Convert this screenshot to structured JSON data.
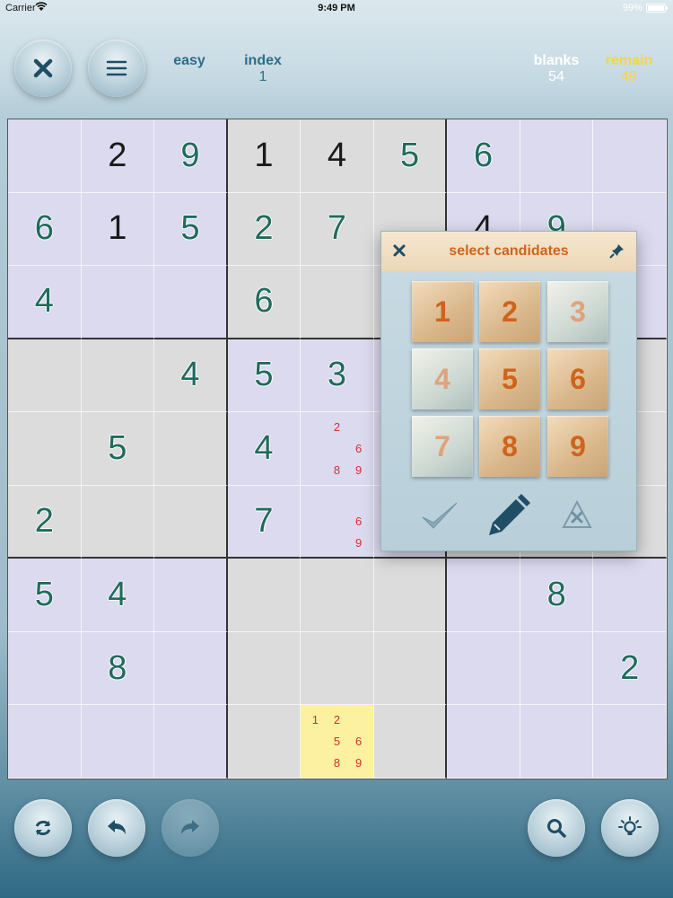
{
  "status": {
    "carrier": "Carrier",
    "time": "9:49 PM",
    "battery": "99%"
  },
  "header": {
    "close_icon": "close-icon",
    "menu_icon": "menu-icon",
    "difficulty": "easy",
    "index_label": "index",
    "index_value": "1",
    "blanks_label": "blanks",
    "blanks_value": "54",
    "remain_label": "remain",
    "remain_value": "49",
    "accent_color": "#2b6f8a",
    "remain_color": "#f3d54a"
  },
  "board": {
    "cells": [
      [
        {
          "v": ""
        },
        {
          "v": "2",
          "t": "given"
        },
        {
          "v": "9",
          "t": "user"
        },
        {
          "v": "1",
          "t": "given"
        },
        {
          "v": "4",
          "t": "given"
        },
        {
          "v": "5",
          "t": "user"
        },
        {
          "v": "6",
          "t": "user"
        },
        {
          "v": ""
        },
        {
          "v": ""
        }
      ],
      [
        {
          "v": "6",
          "t": "user"
        },
        {
          "v": "1",
          "t": "given"
        },
        {
          "v": "5",
          "t": "user"
        },
        {
          "v": "2",
          "t": "user"
        },
        {
          "v": "7",
          "t": "user"
        },
        {
          "v": ""
        },
        {
          "v": "4",
          "t": "given"
        },
        {
          "v": "9",
          "t": "user"
        },
        {
          "v": ""
        }
      ],
      [
        {
          "v": "4",
          "t": "user"
        },
        {
          "v": ""
        },
        {
          "v": ""
        },
        {
          "v": "6",
          "t": "user"
        },
        {
          "v": ""
        },
        {
          "v": ""
        },
        {
          "v": ""
        },
        {
          "v": ""
        },
        {
          "v": ""
        }
      ],
      [
        {
          "v": ""
        },
        {
          "v": ""
        },
        {
          "v": "4",
          "t": "user"
        },
        {
          "v": "5",
          "t": "user"
        },
        {
          "v": "3",
          "t": "user"
        },
        {
          "v": ""
        },
        {
          "v": ""
        },
        {
          "v": ""
        },
        {
          "v": ""
        }
      ],
      [
        {
          "v": ""
        },
        {
          "v": "5",
          "t": "user"
        },
        {
          "v": ""
        },
        {
          "v": "4",
          "t": "user"
        },
        {
          "c": [
            "",
            "2",
            "",
            "",
            "",
            "6",
            "",
            "8",
            "9"
          ]
        },
        {
          "v": ""
        },
        {
          "v": ""
        },
        {
          "v": ""
        },
        {
          "v": ""
        }
      ],
      [
        {
          "v": "2",
          "t": "user"
        },
        {
          "v": ""
        },
        {
          "v": ""
        },
        {
          "v": "7",
          "t": "user"
        },
        {
          "c": [
            "",
            "",
            "",
            "",
            "",
            "6",
            "",
            "",
            "9"
          ]
        },
        {
          "v": ""
        },
        {
          "v": ""
        },
        {
          "v": ""
        },
        {
          "v": ""
        }
      ],
      [
        {
          "v": "5",
          "t": "user"
        },
        {
          "v": "4",
          "t": "user"
        },
        {
          "v": ""
        },
        {
          "v": ""
        },
        {
          "v": ""
        },
        {
          "v": ""
        },
        {
          "v": ""
        },
        {
          "v": "8",
          "t": "user"
        },
        {
          "v": ""
        }
      ],
      [
        {
          "v": ""
        },
        {
          "v": "8",
          "t": "user"
        },
        {
          "v": ""
        },
        {
          "v": ""
        },
        {
          "v": ""
        },
        {
          "v": ""
        },
        {
          "v": ""
        },
        {
          "v": ""
        },
        {
          "v": "2",
          "t": "user"
        }
      ],
      [
        {
          "v": ""
        },
        {
          "v": ""
        },
        {
          "v": ""
        },
        {
          "v": ""
        },
        {
          "c": [
            "1",
            "2",
            "",
            "",
            "5",
            "6",
            "",
            "8",
            "9"
          ],
          "hl": true
        },
        {
          "v": ""
        },
        {
          "v": ""
        },
        {
          "v": ""
        },
        {
          "v": ""
        }
      ]
    ],
    "given_color": "#1a1a1a",
    "user_color": "#1f6b5c",
    "candidate_color": "#d43030",
    "highlight_color": "#fbf1a0"
  },
  "popup": {
    "title": "select candidates",
    "close_icon": "close-icon",
    "pin_icon": "pin-icon",
    "candidates": [
      {
        "label": "1",
        "active": true
      },
      {
        "label": "2",
        "active": true
      },
      {
        "label": "3",
        "active": false
      },
      {
        "label": "4",
        "active": false
      },
      {
        "label": "5",
        "active": true
      },
      {
        "label": "6",
        "active": true
      },
      {
        "label": "7",
        "active": false
      },
      {
        "label": "8",
        "active": true
      },
      {
        "label": "9",
        "active": true
      }
    ],
    "tools": [
      "check-icon",
      "pencil-icon",
      "clear-candidates-icon"
    ],
    "accent_color": "#d0631c"
  },
  "footer": {
    "buttons": [
      "refresh-icon",
      "undo-icon",
      "redo-icon",
      "search-icon",
      "hint-bulb-icon"
    ],
    "redo_enabled": false
  }
}
